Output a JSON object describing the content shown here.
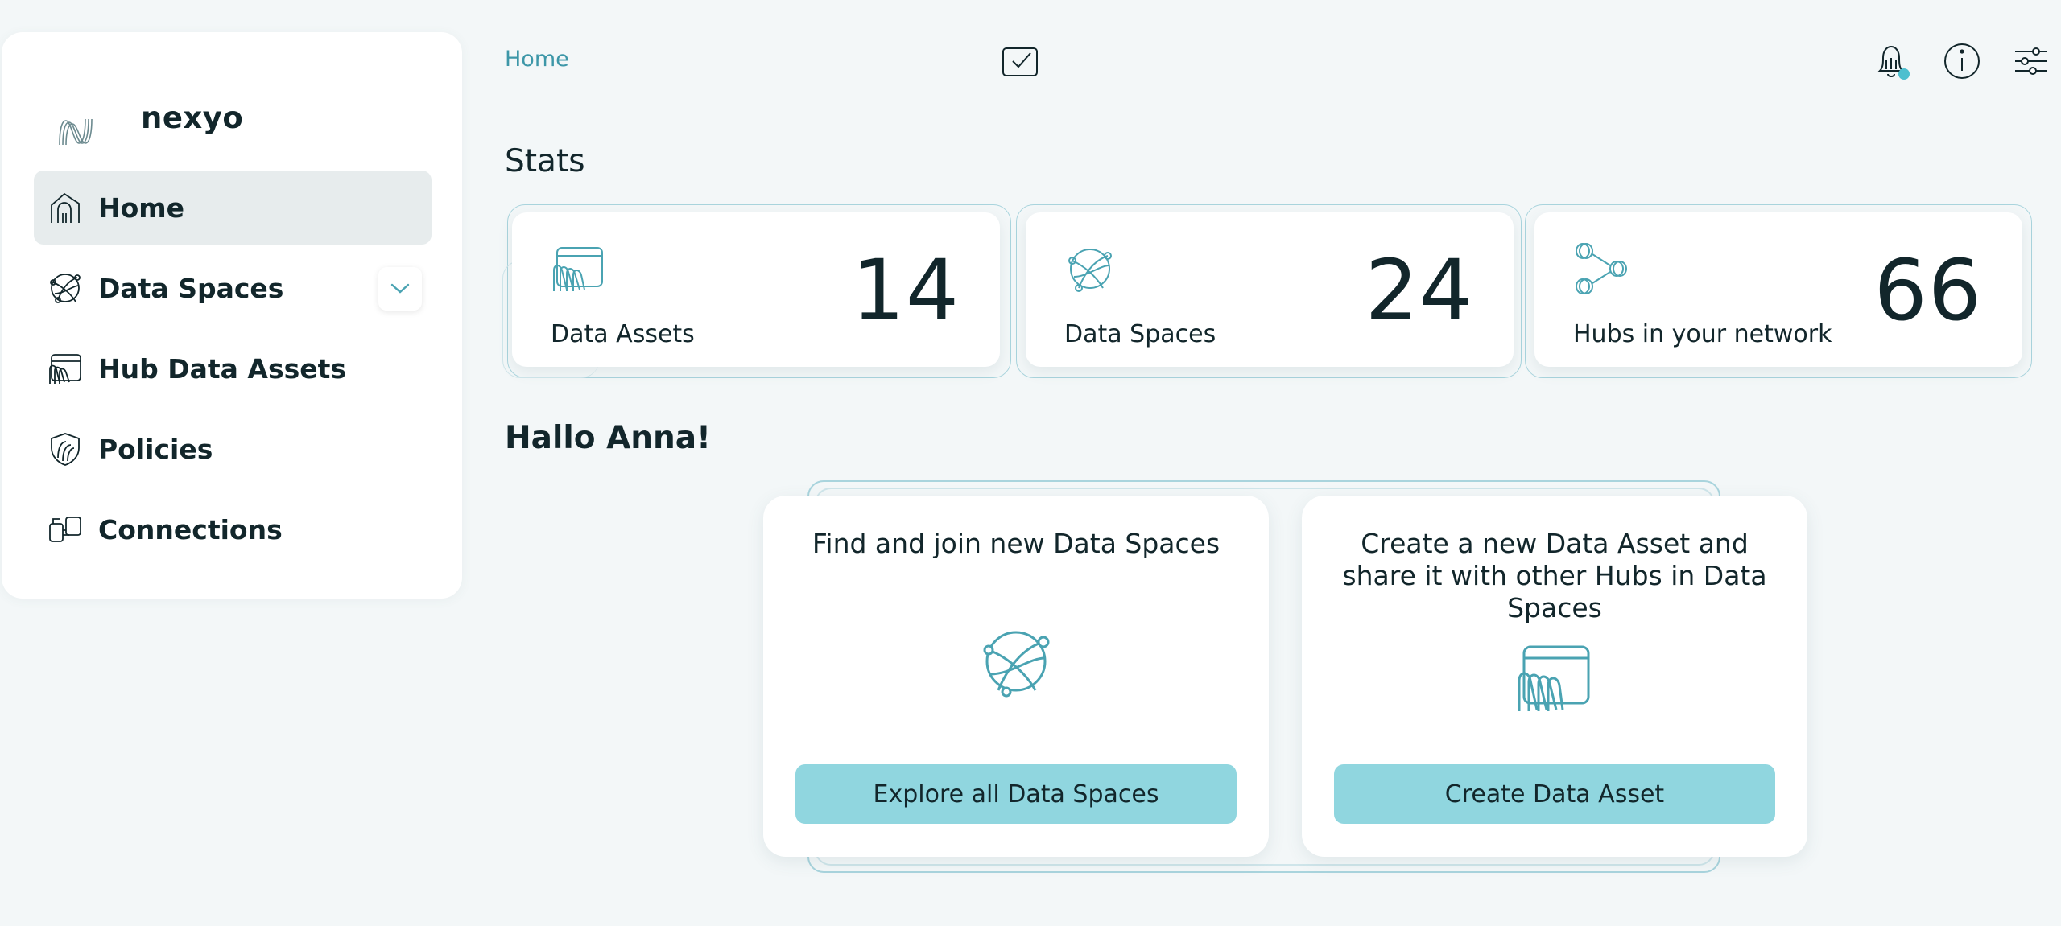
{
  "app": {
    "brand_name": "nexyo"
  },
  "sidebar": {
    "items": [
      {
        "label": "Home",
        "icon": "home-icon",
        "active": true
      },
      {
        "label": "Data Spaces",
        "icon": "globe-network-icon"
      },
      {
        "label": "Hub Data Assets",
        "icon": "data-asset-icon"
      },
      {
        "label": "Policies",
        "icon": "shield-icon"
      },
      {
        "label": "Connections",
        "icon": "connections-icon"
      }
    ]
  },
  "header": {
    "breadcrumb": "Home",
    "icons": [
      "tasks-check-icon",
      "bell-icon",
      "info-icon",
      "settings-sliders-icon"
    ],
    "notification_dot_color": "#4dbfcf"
  },
  "stats": {
    "title": "Stats",
    "cards": [
      {
        "label": "Data Assets",
        "value": "14",
        "icon": "data-asset-icon"
      },
      {
        "label": "Data Spaces",
        "value": "24",
        "icon": "globe-network-icon"
      },
      {
        "label": "Hubs in your network",
        "value": "66",
        "icon": "hubs-network-icon"
      }
    ]
  },
  "greeting": {
    "title": "Hallo Anna!"
  },
  "actions": [
    {
      "text": "Find and join new Data Spaces",
      "button": "Explore all Data Spaces",
      "icon": "globe-network-icon"
    },
    {
      "text": "Create a new Data Asset and share it with other Hubs in Data Spaces",
      "button": "Create Data Asset",
      "icon": "data-asset-icon"
    }
  ],
  "colors": {
    "accent": "#4aa3b2",
    "button": "#90d6df",
    "background": "#f3f7f8"
  }
}
